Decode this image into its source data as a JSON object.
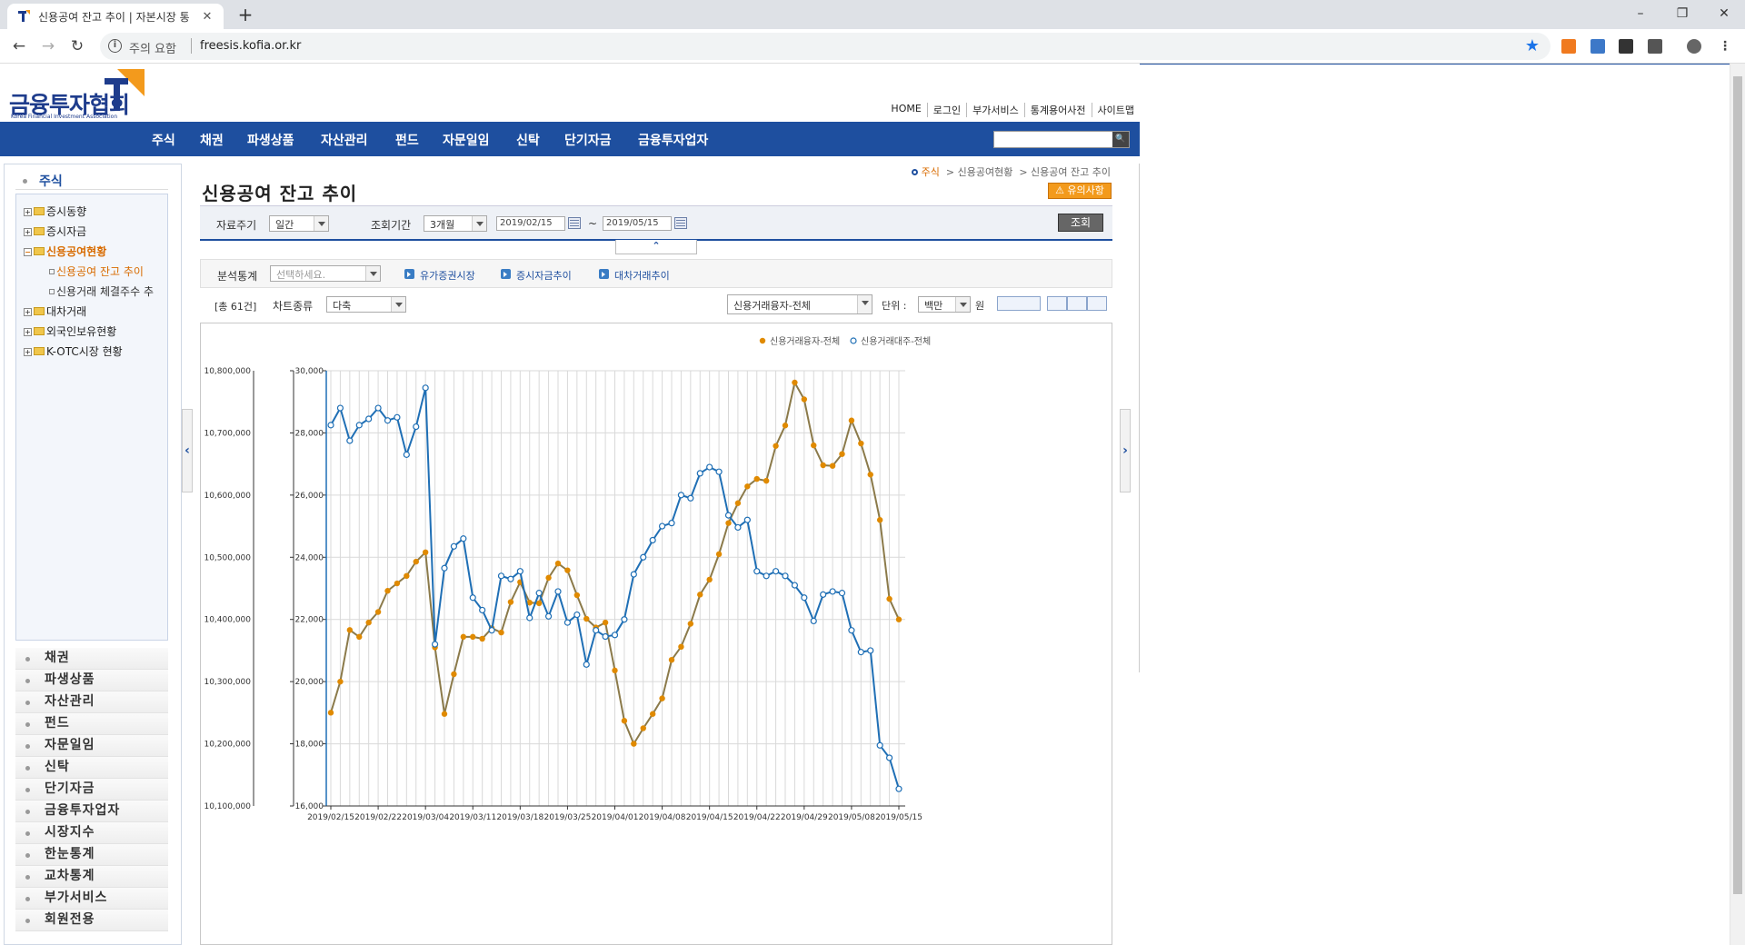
{
  "browser": {
    "tab_title": "신용공여 잔고 추이 | 자본시장 통",
    "tab_close": "✕",
    "new_tab": "+",
    "window_minimize": "–",
    "window_maximize": "❐",
    "window_close": "✕",
    "security_label": "주의 요함",
    "url": "freesis.kofia.or.kr",
    "back": "←",
    "forward": "→",
    "reload": "↻",
    "bookmark_star": "★"
  },
  "header": {
    "logo_text": "금융투자협회",
    "logo_sub": "Korea Financial Investment Association",
    "top_links": [
      "HOME",
      "로그인",
      "부가서비스",
      "통계용어사전",
      "사이트맵"
    ],
    "gnb": [
      "주식",
      "채권",
      "파생상품",
      "자산관리",
      "펀드",
      "자문일임",
      "신탁",
      "단기자금",
      "금융투자업자"
    ],
    "search_button": "🔍"
  },
  "sidebar": {
    "title": "주식",
    "tree": [
      {
        "label": "증시동향",
        "pm": "+"
      },
      {
        "label": "증시자금",
        "pm": "+"
      },
      {
        "label": "신용공여현황",
        "pm": "−",
        "active": true
      },
      {
        "label": "대차거래",
        "pm": "+"
      },
      {
        "label": "외국인보유현황",
        "pm": "+"
      },
      {
        "label": "K-OTC시장 현황",
        "pm": "+"
      }
    ],
    "leaves": [
      "신용공여 잔고 추이",
      "신용거래 체결주수 추"
    ],
    "menu": [
      "채권",
      "파생상품",
      "자산관리",
      "펀드",
      "자문일임",
      "신탁",
      "단기자금",
      "금융투자업자",
      "시장지수",
      "한눈통계",
      "교차통계",
      "부가서비스",
      "회원전용"
    ],
    "collapse_left": "‹",
    "expand_right": "›"
  },
  "main": {
    "breadcrumb_home": "주식",
    "breadcrumb_1": "> 신용공여현황",
    "breadcrumb_2": "> 신용공여 잔고 추이",
    "notice_button": "⚠ 유의사항",
    "title": "신용공여 잔고 추이",
    "filter": {
      "period_label": "자료주기",
      "period_value": "일간",
      "range_label": "조회기간",
      "range_value": "3개월",
      "start_date": "2019/02/15",
      "tilde": "~",
      "end_date": "2019/05/15",
      "search_button": "조회",
      "collapse": "⌃"
    },
    "analysis": {
      "label": "분석통계",
      "placeholder": "선택하세요.",
      "links": [
        "유가증권시장",
        "증시자금추이",
        "대차거래추이"
      ]
    },
    "toolbar": {
      "count": "[총 61건]",
      "chart_type_label": "차트종류",
      "chart_type_value": "다축",
      "series_select": "신용거래융자-전체",
      "unit_label": "단위 :",
      "unit_value": "백만",
      "unit_suffix": "원"
    }
  },
  "chart_data": {
    "type": "line",
    "legend_position": "top-right",
    "series": [
      {
        "name": "신용거래융자-전체",
        "axis": "left",
        "color": "#e08a00",
        "line_color": "#8b7a4a",
        "values": [
          10250000,
          10300000,
          10383000,
          10372000,
          10395000,
          10412000,
          10446000,
          10458000,
          10470000,
          10493000,
          10508000,
          10355000,
          10248000,
          10312000,
          10372000,
          10372000,
          10369000,
          10386000,
          10379000,
          10428000,
          10460000,
          10427000,
          10426000,
          10467000,
          10490000,
          10479000,
          10439000,
          10401000,
          10387000,
          10395000,
          10318000,
          10237000,
          10200000,
          10225000,
          10248000,
          10273000,
          10335000,
          10356000,
          10393000,
          10440000,
          10464000,
          10505000,
          10555000,
          10587000,
          10614000,
          10626000,
          10623000,
          10679000,
          10712000,
          10781000,
          10754000,
          10680000,
          10648000,
          10647000,
          10666000,
          10720000,
          10683000,
          10633000,
          10560000,
          10433000,
          10400000
        ]
      },
      {
        "name": "신용거래대주-전체",
        "axis": "right",
        "color": "#1f6fb5",
        "values": [
          28250,
          28800,
          27750,
          28250,
          28450,
          28800,
          28400,
          28500,
          27300,
          28200,
          29450,
          21200,
          23650,
          24350,
          24600,
          22700,
          22300,
          21650,
          23400,
          23300,
          23550,
          22050,
          22850,
          22100,
          22900,
          21900,
          22150,
          20550,
          21650,
          21450,
          21500,
          22000,
          23450,
          24000,
          24550,
          25000,
          25100,
          26000,
          25900,
          26700,
          26900,
          26750,
          25350,
          24960,
          25200,
          23550,
          23400,
          23550,
          23400,
          23100,
          22700,
          21950,
          22800,
          22900,
          22850,
          21650,
          20950,
          21000,
          17950,
          17550,
          16550
        ]
      }
    ],
    "x_tick_labels": [
      "2019/02/15",
      "2019/02/22",
      "2019/03/04",
      "2019/03/11",
      "2019/03/18",
      "2019/03/25",
      "2019/04/01",
      "2019/04/08",
      "2019/04/15",
      "2019/04/22",
      "2019/04/29",
      "2019/05/08",
      "2019/05/15"
    ],
    "y_left": {
      "min": 10100000,
      "max": 10800000,
      "step": 100000,
      "tick_labels": [
        "10,100,000",
        "10,200,000",
        "10,300,000",
        "10,400,000",
        "10,500,000",
        "10,600,000",
        "10,700,000",
        "10,800,000"
      ]
    },
    "y_right": {
      "min": 16000,
      "max": 30000,
      "step": 2000,
      "tick_labels": [
        "16,000",
        "18,000",
        "20,000",
        "22,000",
        "24,000",
        "26,000",
        "28,000",
        "30,000"
      ]
    },
    "grid": true
  }
}
